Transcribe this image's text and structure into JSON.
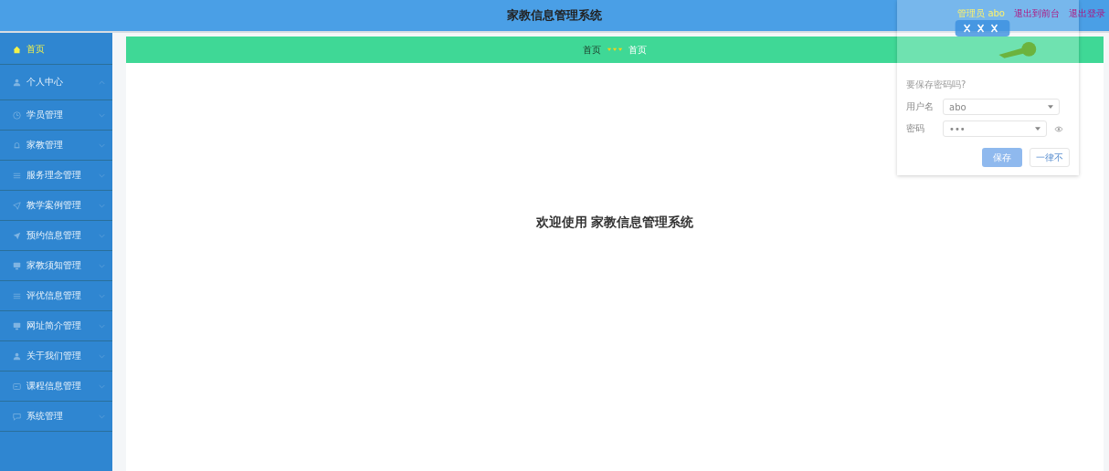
{
  "header": {
    "title": "家教信息管理系统",
    "user": "管理员 abo",
    "links": [
      "退出到前台",
      "退出登录"
    ]
  },
  "sidebar": {
    "items": [
      {
        "label": "首页",
        "kind": "link",
        "selected": true
      },
      {
        "label": "个人中心",
        "kind": "menu",
        "selected": false,
        "expanded": true
      },
      {
        "label": "学员管理",
        "kind": "menu",
        "selected": false,
        "expanded": false
      },
      {
        "label": "家教管理",
        "kind": "menu",
        "selected": false,
        "expanded": false
      },
      {
        "label": "服务理念管理",
        "kind": "menu",
        "selected": false,
        "expanded": false
      },
      {
        "label": "教学案例管理",
        "kind": "menu",
        "selected": false,
        "expanded": false
      },
      {
        "label": "预约信息管理",
        "kind": "menu",
        "selected": false,
        "expanded": false
      },
      {
        "label": "家教须知管理",
        "kind": "menu",
        "selected": false,
        "expanded": false
      },
      {
        "label": "评优信息管理",
        "kind": "menu",
        "selected": false,
        "expanded": false
      },
      {
        "label": "网址简介管理",
        "kind": "menu",
        "selected": false,
        "expanded": false
      },
      {
        "label": "关于我们管理",
        "kind": "menu",
        "selected": false,
        "expanded": false
      },
      {
        "label": "课程信息管理",
        "kind": "menu",
        "selected": false,
        "expanded": false
      },
      {
        "label": "系统管理",
        "kind": "menu",
        "selected": false,
        "expanded": false
      }
    ]
  },
  "breadcrumb": [
    "首页",
    "首页"
  ],
  "welcome": "欢迎使用 家教信息管理系统",
  "password_prompt": {
    "title": "要保存密码吗?",
    "fields": [
      {
        "label": "用户名",
        "value": "abo"
      },
      {
        "label": "密码",
        "value": "•••",
        "kind": "password"
      }
    ],
    "buttons": [
      {
        "label": "保存",
        "kind": "primary"
      },
      {
        "label": "一律不",
        "kind": "plain"
      }
    ]
  }
}
